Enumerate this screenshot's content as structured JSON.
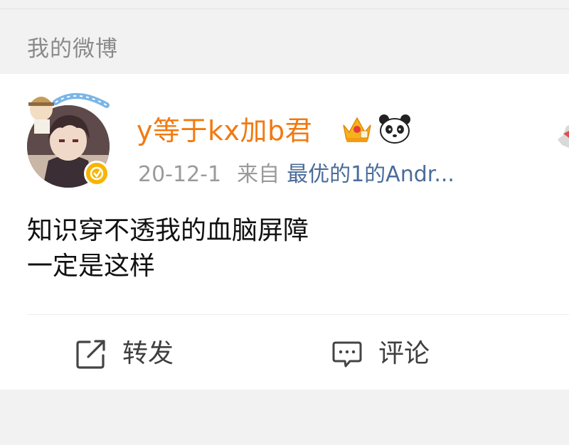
{
  "section": {
    "title": "我的微博"
  },
  "post": {
    "username": "y等于kx加b君",
    "date": "20-12-1",
    "from_label": "来自",
    "source": "最优的1的Andr...",
    "content_lines": [
      "知识穿不透我的血脑屏障",
      "一定是这样"
    ]
  },
  "actions": {
    "repost_label": "转发",
    "comment_label": "评论"
  },
  "colors": {
    "username": "#f07a12",
    "source_link": "#4a6c9a",
    "verified_badge": "#f7b500",
    "background": "#f2f2f2"
  },
  "icons": {
    "crown": "crown-icon",
    "panda": "panda-icon",
    "verified": "verified-badge-icon",
    "repost": "share-box-icon",
    "comment": "comment-bubble-icon"
  }
}
